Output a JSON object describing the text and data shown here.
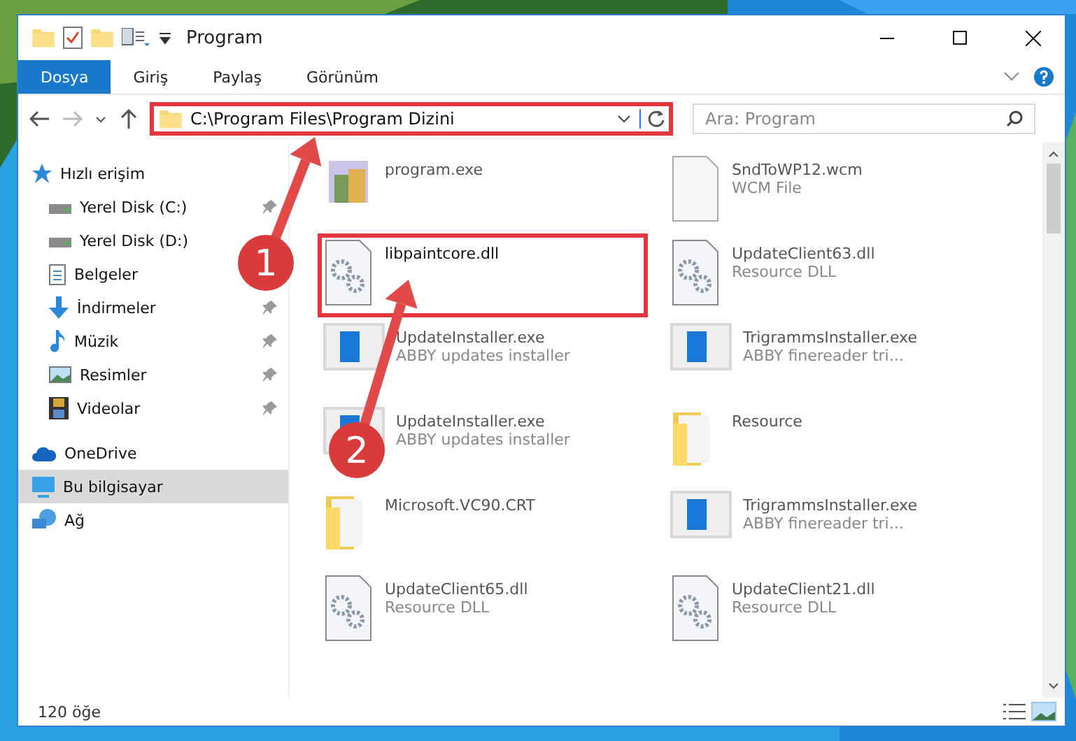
{
  "window": {
    "title": "Program"
  },
  "ribbon_tabs": [
    {
      "label": "Dosya",
      "selected": true
    },
    {
      "label": "Giriş",
      "selected": false
    },
    {
      "label": "Paylaş",
      "selected": false
    },
    {
      "label": "Görünüm",
      "selected": false
    }
  ],
  "address": {
    "path": "C:\\Program Files\\Program Dizini",
    "highlighted": true
  },
  "search": {
    "placeholder": "Ara: Program"
  },
  "sidebar": {
    "items": [
      {
        "label": "Hızlı erişim",
        "kind": "quick",
        "pinned": false,
        "selected": false,
        "children": [
          {
            "label": "Yerel Disk (C:)",
            "kind": "disk",
            "pinned": true,
            "selected": false
          },
          {
            "label": "Yerel Disk (D:)",
            "kind": "disk",
            "pinned": false,
            "selected": false
          },
          {
            "label": "Belgeler",
            "kind": "docs",
            "pinned": false,
            "selected": false
          },
          {
            "label": "İndirmeler",
            "kind": "download",
            "pinned": true,
            "selected": false
          },
          {
            "label": "Müzik",
            "kind": "music",
            "pinned": true,
            "selected": false
          },
          {
            "label": "Resimler",
            "kind": "pictures",
            "pinned": true,
            "selected": false
          },
          {
            "label": "Videolar",
            "kind": "video",
            "pinned": true,
            "selected": false
          }
        ]
      },
      {
        "label": "OneDrive",
        "kind": "cloud",
        "pinned": false,
        "selected": false
      },
      {
        "label": "Bu bilgisayar",
        "kind": "pc",
        "pinned": false,
        "selected": true
      },
      {
        "label": "Ağ",
        "kind": "network",
        "pinned": false,
        "selected": false
      }
    ]
  },
  "files": [
    {
      "name": "program.exe",
      "kind": "exe",
      "highlighted": false
    },
    {
      "name": "SndToWP12.wcm",
      "type": "WCM File",
      "kind": "file",
      "highlighted": false
    },
    {
      "name": "libpaintcore.dll",
      "kind": "dll",
      "highlighted": true
    },
    {
      "name": "UpdateClient63.dll",
      "type": "Resource DLL",
      "kind": "dll",
      "highlighted": false
    },
    {
      "name": "UpdateInstaller.exe",
      "type": "ABBY updates installer",
      "kind": "installer",
      "highlighted": false
    },
    {
      "name": "TrigrammsInstaller.exe",
      "type": "ABBY finereader tri...",
      "kind": "installer",
      "highlighted": false
    },
    {
      "name": "UpdateInstaller.exe",
      "type": "ABBY updates installer",
      "kind": "installer",
      "highlighted": false
    },
    {
      "name": "Resource",
      "kind": "folder",
      "highlighted": false
    },
    {
      "name": "Microsoft.VC90.CRT",
      "kind": "folder",
      "highlighted": false
    },
    {
      "name": "TrigrammsInstaller.exe",
      "type": "ABBY finereader tri...",
      "kind": "installer",
      "highlighted": false
    },
    {
      "name": "UpdateClient65.dll",
      "type": "Resource DLL",
      "kind": "dll",
      "highlighted": false
    },
    {
      "name": "UpdateClient21.dll",
      "type": "Resource DLL",
      "kind": "dll",
      "highlighted": false
    }
  ],
  "status_bar": {
    "count": "120 öğe"
  },
  "annotations": [
    {
      "number": "1"
    },
    {
      "number": "2"
    }
  ]
}
